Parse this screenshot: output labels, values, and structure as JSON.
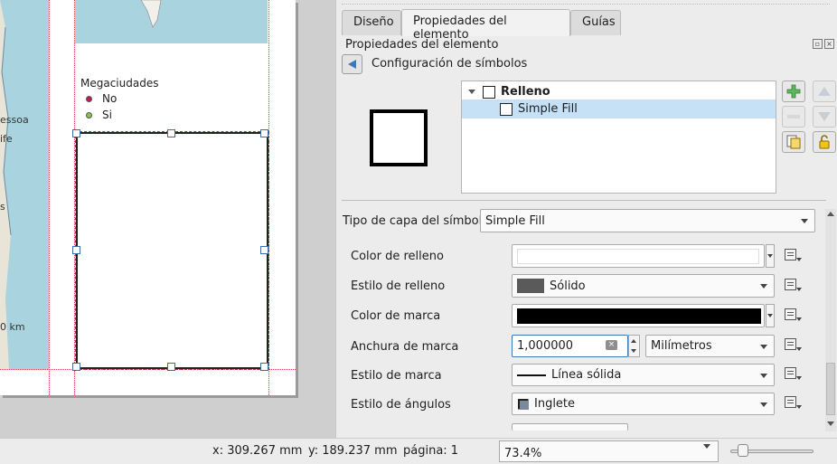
{
  "canvas": {
    "map_labels": [
      "essoa",
      "ife",
      "s",
      "0 km"
    ],
    "legend": {
      "title": "Megaciudades",
      "items": [
        {
          "label": "No",
          "color": "#c21a4e"
        },
        {
          "label": "Si",
          "color": "#8bc34a"
        }
      ]
    }
  },
  "panel": {
    "tabs": [
      {
        "label": "Diseño",
        "active": false
      },
      {
        "label": "Propiedades del elemento",
        "active": true
      },
      {
        "label": "Guías",
        "active": false
      }
    ],
    "title": "Propiedades del elemento",
    "breadcrumb": "Configuración de símbolos",
    "symbol_tree": {
      "parent": "Relleno",
      "child": "Simple Fill"
    },
    "symbol_layer_type": {
      "label": "Tipo de capa del símbolo",
      "value": "Simple Fill"
    },
    "properties": {
      "fill_color": {
        "label": "Color de relleno",
        "value": "#ffffff"
      },
      "fill_style": {
        "label": "Estilo de relleno",
        "value": "Sólido",
        "swatch": "#5a5a5a"
      },
      "stroke_color": {
        "label": "Color de marca",
        "value": "#000000"
      },
      "stroke_width": {
        "label": "Anchura de marca",
        "value": "1,000000",
        "unit": "Milímetros"
      },
      "stroke_style": {
        "label": "Estilo de marca",
        "value": "Línea sólida"
      },
      "join_style": {
        "label": "Estilo de ángulos",
        "value": "Inglete"
      }
    }
  },
  "status": {
    "x": "x: 309.267 mm",
    "y": "y: 189.237 mm",
    "page": "página: 1",
    "zoom": "73.4%",
    "zoom_slider_fraction": 0.1
  },
  "colors": {
    "accent": "#3d78b8",
    "selection": "#c6e0f5",
    "map_water": "#a9d3de"
  }
}
